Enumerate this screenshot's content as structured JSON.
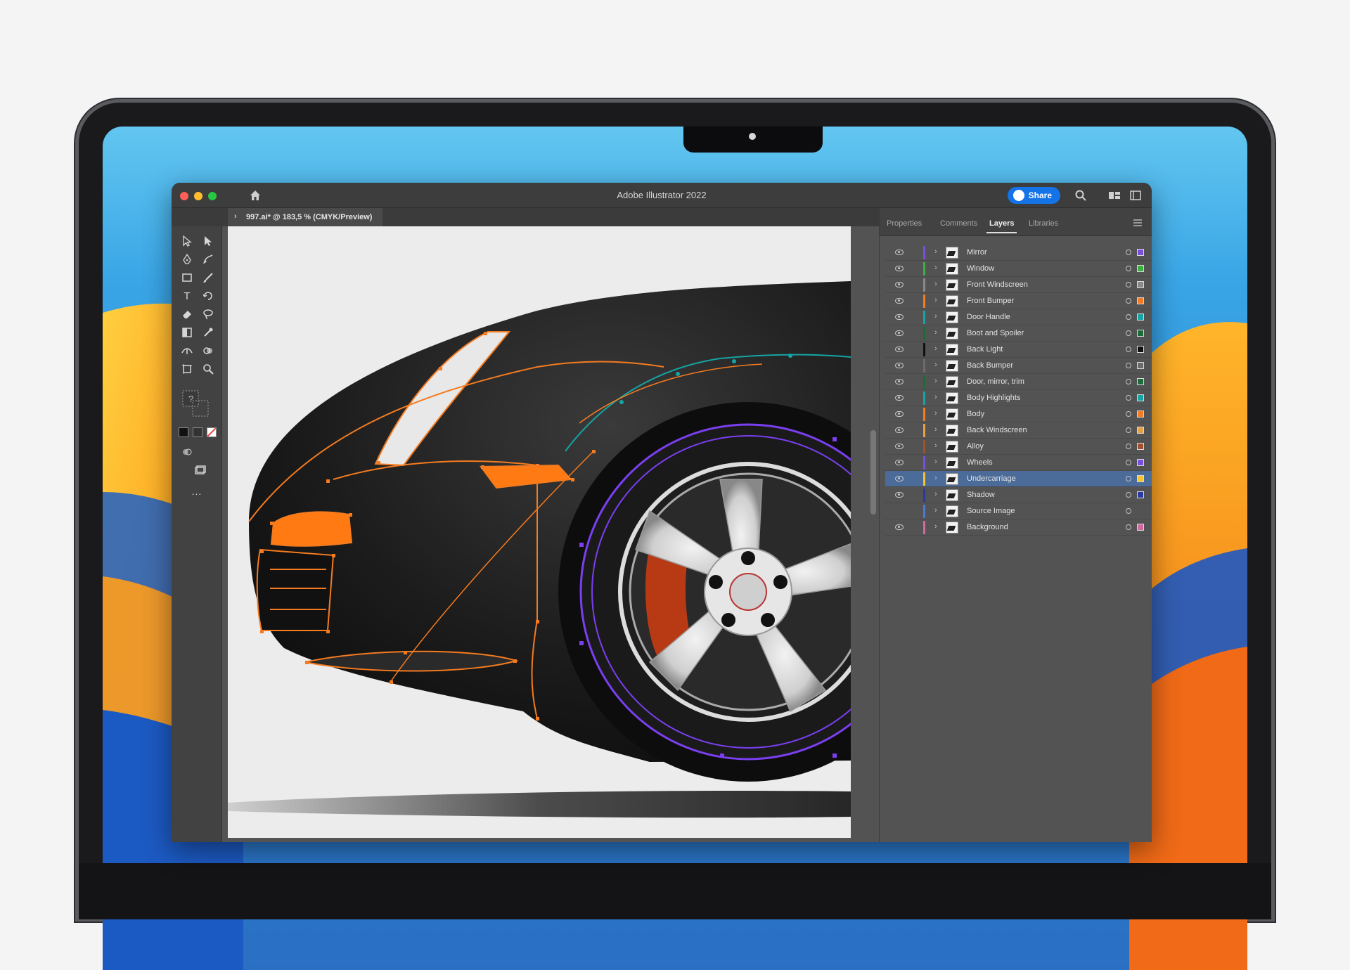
{
  "window": {
    "title": "Adobe Illustrator 2022",
    "share_label": "Share",
    "document_tab": "997.ai* @ 183,5 % (CMYK/Preview)"
  },
  "panel": {
    "tabs": [
      {
        "label": "Properties"
      },
      {
        "label": "Comments"
      },
      {
        "label": "Layers",
        "active": true
      },
      {
        "label": "Libraries"
      }
    ],
    "layers": [
      {
        "name": "Mirror",
        "color": "#7a4fe0",
        "swatch": "#7a4fe0"
      },
      {
        "name": "Window",
        "color": "#3cb043",
        "swatch": "#3cb043"
      },
      {
        "name": "Front Windscreen",
        "color": "#8a8a8a",
        "swatch": "#8a8a8a"
      },
      {
        "name": "Front Bumper",
        "color": "#f47b20",
        "swatch": "#f47b20"
      },
      {
        "name": "Door Handle",
        "color": "#15a5a5",
        "swatch": "#15a5a5"
      },
      {
        "name": "Boot and Spoiler",
        "color": "#1e6b3a",
        "swatch": "#1e6b3a"
      },
      {
        "name": "Back Light",
        "color": "#111111",
        "swatch": "#111111"
      },
      {
        "name": "Back Bumper",
        "color": "#6b6b6b",
        "swatch": "#6b6b6b"
      },
      {
        "name": "Door, mirror, trim",
        "color": "#1e6b3a",
        "swatch": "#1e6b3a"
      },
      {
        "name": "Body Highlights",
        "color": "#15a5a5",
        "swatch": "#15a5a5"
      },
      {
        "name": "Body",
        "color": "#f47b20",
        "swatch": "#f47b20"
      },
      {
        "name": "Back Windscreen",
        "color": "#e2a14a",
        "swatch": "#e2a14a"
      },
      {
        "name": "Alloy",
        "color": "#a0522d",
        "swatch": "#a0522d"
      },
      {
        "name": "Wheels",
        "color": "#7a4fe0",
        "swatch": "#7a4fe0"
      },
      {
        "name": "Undercarriage",
        "color": "#f4c430",
        "swatch": "#f4c430",
        "selected": true
      },
      {
        "name": "Shadow",
        "color": "#2a3aa0",
        "swatch": "#2a3aa0"
      },
      {
        "name": "Source Image",
        "color": "#4a7bd0",
        "swatch": ""
      },
      {
        "name": "Background",
        "color": "#d06aa0",
        "swatch": "#d06aa0"
      }
    ]
  },
  "toolbar": {
    "tools": [
      "selection-tool",
      "direct-selection-tool",
      "pen-tool",
      "curvature-tool",
      "rectangle-tool",
      "paintbrush-tool",
      "type-tool",
      "rotate-tool",
      "eraser-tool",
      "lasso-tool",
      "gradient-tool",
      "eyedropper-tool",
      "width-tool",
      "shape-builder-tool",
      "artboard-tool",
      "zoom-tool"
    ],
    "more_label": "..."
  },
  "colors": {
    "ui_dark": "#535353",
    "accent_blue": "#1473e6",
    "path_orange": "#f47b20",
    "path_purple": "#7a3ff0"
  }
}
